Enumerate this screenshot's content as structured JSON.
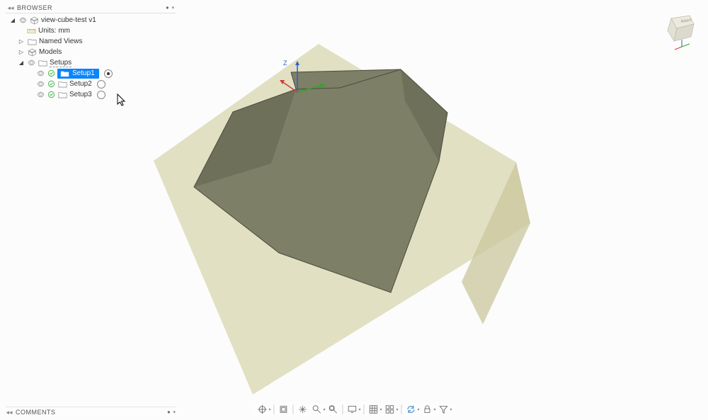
{
  "browserPanel": {
    "title": "BROWSER",
    "root": "view-cube-test v1",
    "units": "Units: mm",
    "namedViews": "Named Views",
    "models": "Models",
    "setups": "Setups",
    "setup1": "Setup1",
    "setup2": "Setup2",
    "setup3": "Setup3"
  },
  "commentsPanel": {
    "title": "COMMENTS"
  },
  "viewcube": {
    "label": "RIGHT"
  },
  "axis": {
    "z": "Z"
  },
  "icons": {
    "collapse": "◂◂",
    "triExpanded": "◢",
    "triCollapsed": "▷"
  }
}
